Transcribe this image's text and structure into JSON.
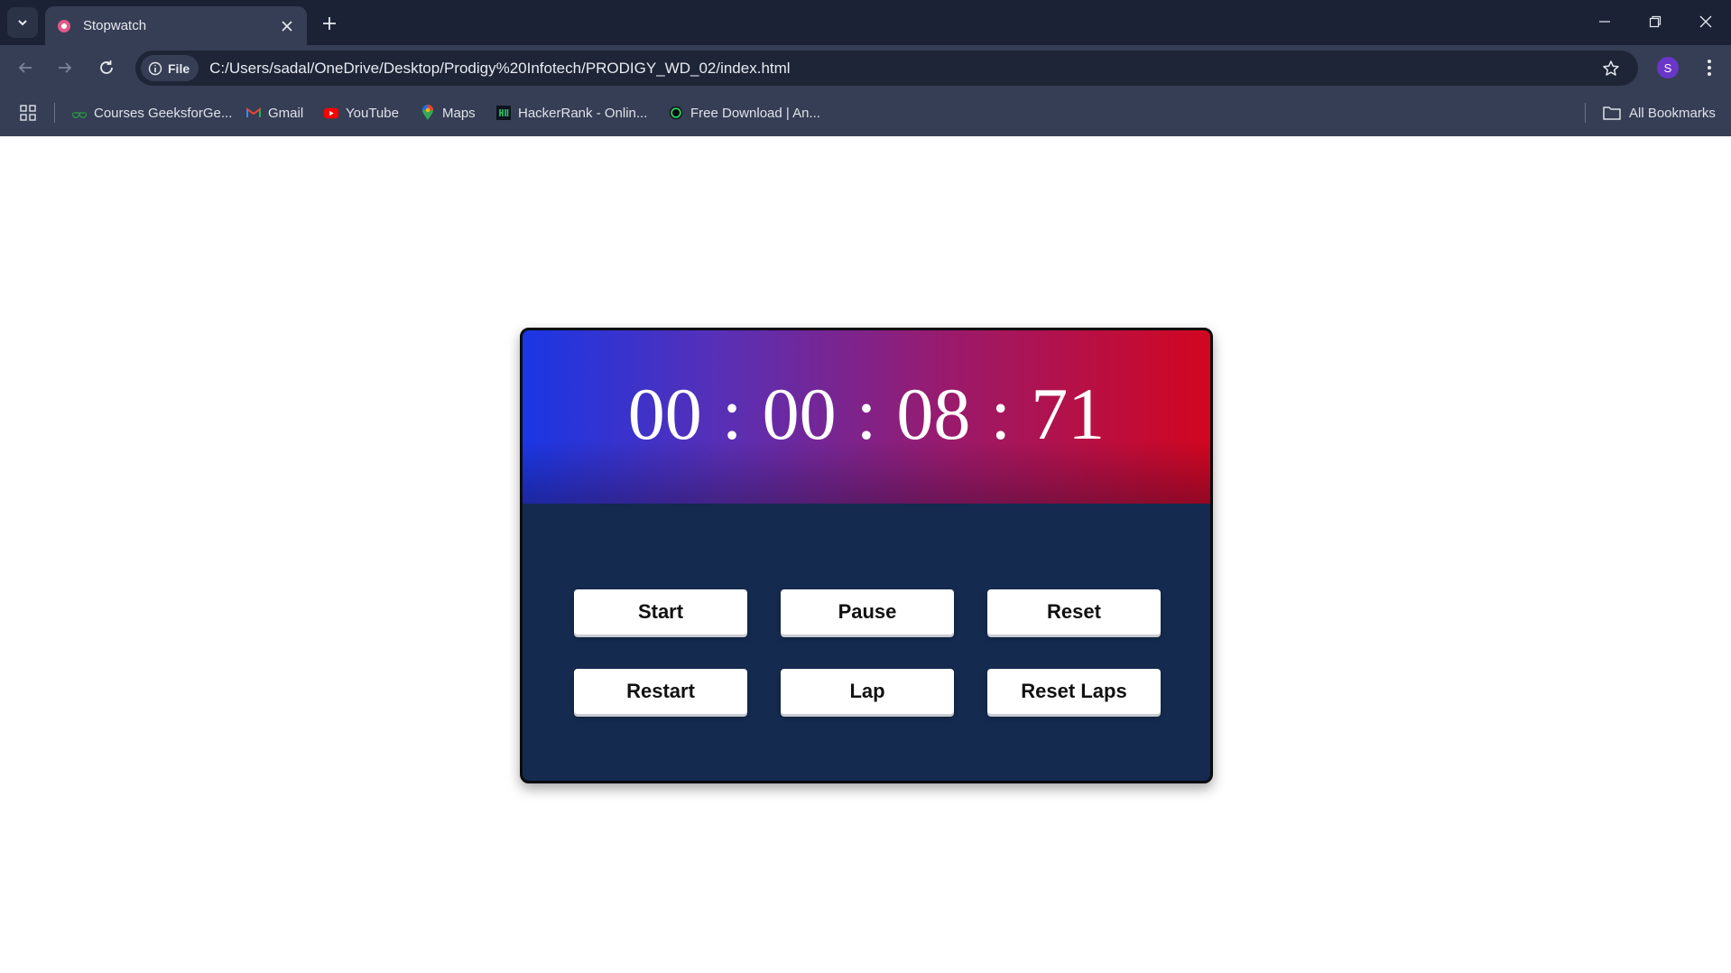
{
  "browser": {
    "tab_title": "Stopwatch",
    "site_chip_label": "File",
    "url": "C:/Users/sadal/OneDrive/Desktop/Prodigy%20Infotech/PRODIGY_WD_02/index.html",
    "profile_initial": "S",
    "bookmarks": [
      {
        "label": "Courses GeeksforGe...",
        "icon": "geeksforgeeks-icon"
      },
      {
        "label": "Gmail",
        "icon": "gmail-icon"
      },
      {
        "label": "YouTube",
        "icon": "youtube-icon"
      },
      {
        "label": "Maps",
        "icon": "maps-icon"
      },
      {
        "label": "HackerRank - Onlin...",
        "icon": "hackerrank-icon"
      },
      {
        "label": "Free Download | An...",
        "icon": "download-site-icon"
      }
    ],
    "all_bookmarks_label": "All Bookmarks"
  },
  "stopwatch": {
    "hours": "00",
    "minutes": "00",
    "seconds": "08",
    "centiseconds": "71",
    "separator": ":",
    "buttons": {
      "start": "Start",
      "pause": "Pause",
      "reset": "Reset",
      "restart": "Restart",
      "lap": "Lap",
      "reset_laps": "Reset Laps"
    },
    "colors": {
      "gradient_start": "#1a36e4",
      "gradient_end": "#d20620",
      "panel_background": "#142a4f"
    }
  }
}
